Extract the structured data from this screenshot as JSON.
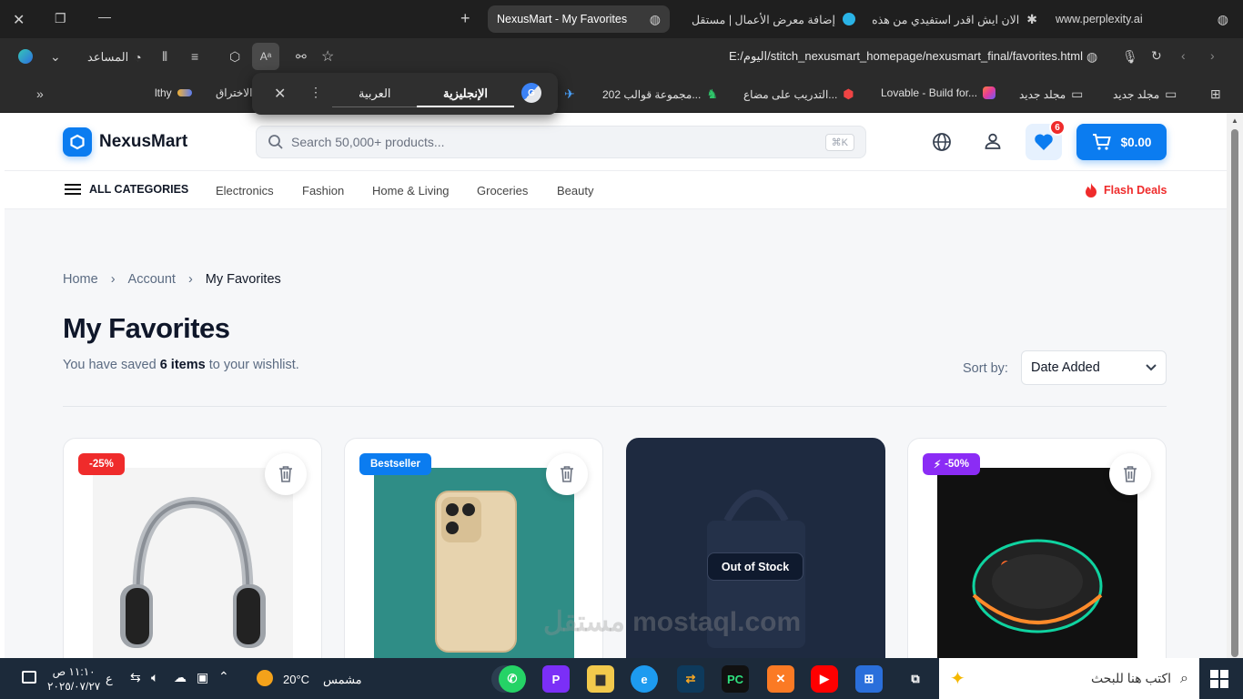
{
  "browser": {
    "tabs": [
      {
        "label": "www.perplexity.ai"
      },
      {
        "label": "الان ايش اقدر استفيدي من هذه"
      },
      {
        "label": "إضافة معرض الأعمال | مستقل"
      },
      {
        "label": "NexusMart - My Favorites"
      }
    ],
    "address": "E:/اليوم/stitch_nexusmart_homepage/nexusmart_final/favorites.html",
    "assistant_label": "المساعد",
    "bookmarks": [
      {
        "label": "مجلد جديد"
      },
      {
        "label": "مجلد جديد"
      },
      {
        "label": "Lovable - Build for..."
      },
      {
        "label": "التدريب على مضاع..."
      },
      {
        "label": "مجموعة قوالب 202..."
      },
      {
        "label": "الاختراق"
      },
      {
        "label": "lthy"
      }
    ],
    "translate": {
      "lang_english": "الإنجليزية",
      "lang_arabic": "العربية"
    }
  },
  "site": {
    "brand": "NexusMart",
    "search_placeholder": "Search 50,000+ products...",
    "search_shortcut": "⌘K",
    "favorites_count": "6",
    "cart_total": "$0.00",
    "all_categories": "ALL CATEGORIES",
    "categories": [
      "Electronics",
      "Fashion",
      "Home & Living",
      "Groceries",
      "Beauty"
    ],
    "flash_deals": "Flash Deals",
    "accent": "#0b7cf0"
  },
  "breadcrumb": [
    "Home",
    "Account",
    "My Favorites"
  ],
  "page_title": "My Favorites",
  "subtitle": {
    "prefix": "You have saved ",
    "count": "6 items",
    "suffix": " to your wishlist."
  },
  "sort": {
    "label": "Sort by:",
    "selected": "Date Added"
  },
  "cards": [
    {
      "badge": "-25%",
      "badge_color": "#ef2b2b",
      "image": "headphones"
    },
    {
      "badge": "Bestseller",
      "badge_color": "#0b7cf0",
      "image": "phone"
    },
    {
      "status": "Out of Stock",
      "image": "bag"
    },
    {
      "badge": "-50%",
      "badge_color": "#8b2cf5",
      "image": "mouse"
    }
  ],
  "taskbar": {
    "search_placeholder": "اكتب هنا للبحث",
    "weather_temp": "20°C",
    "weather_text": "مشمس",
    "time": "١١:١٠ ص",
    "date": "٢٠٢٥/٠٧/٢٧",
    "lang": "ع"
  },
  "watermark": "مستقل mostaql.com"
}
